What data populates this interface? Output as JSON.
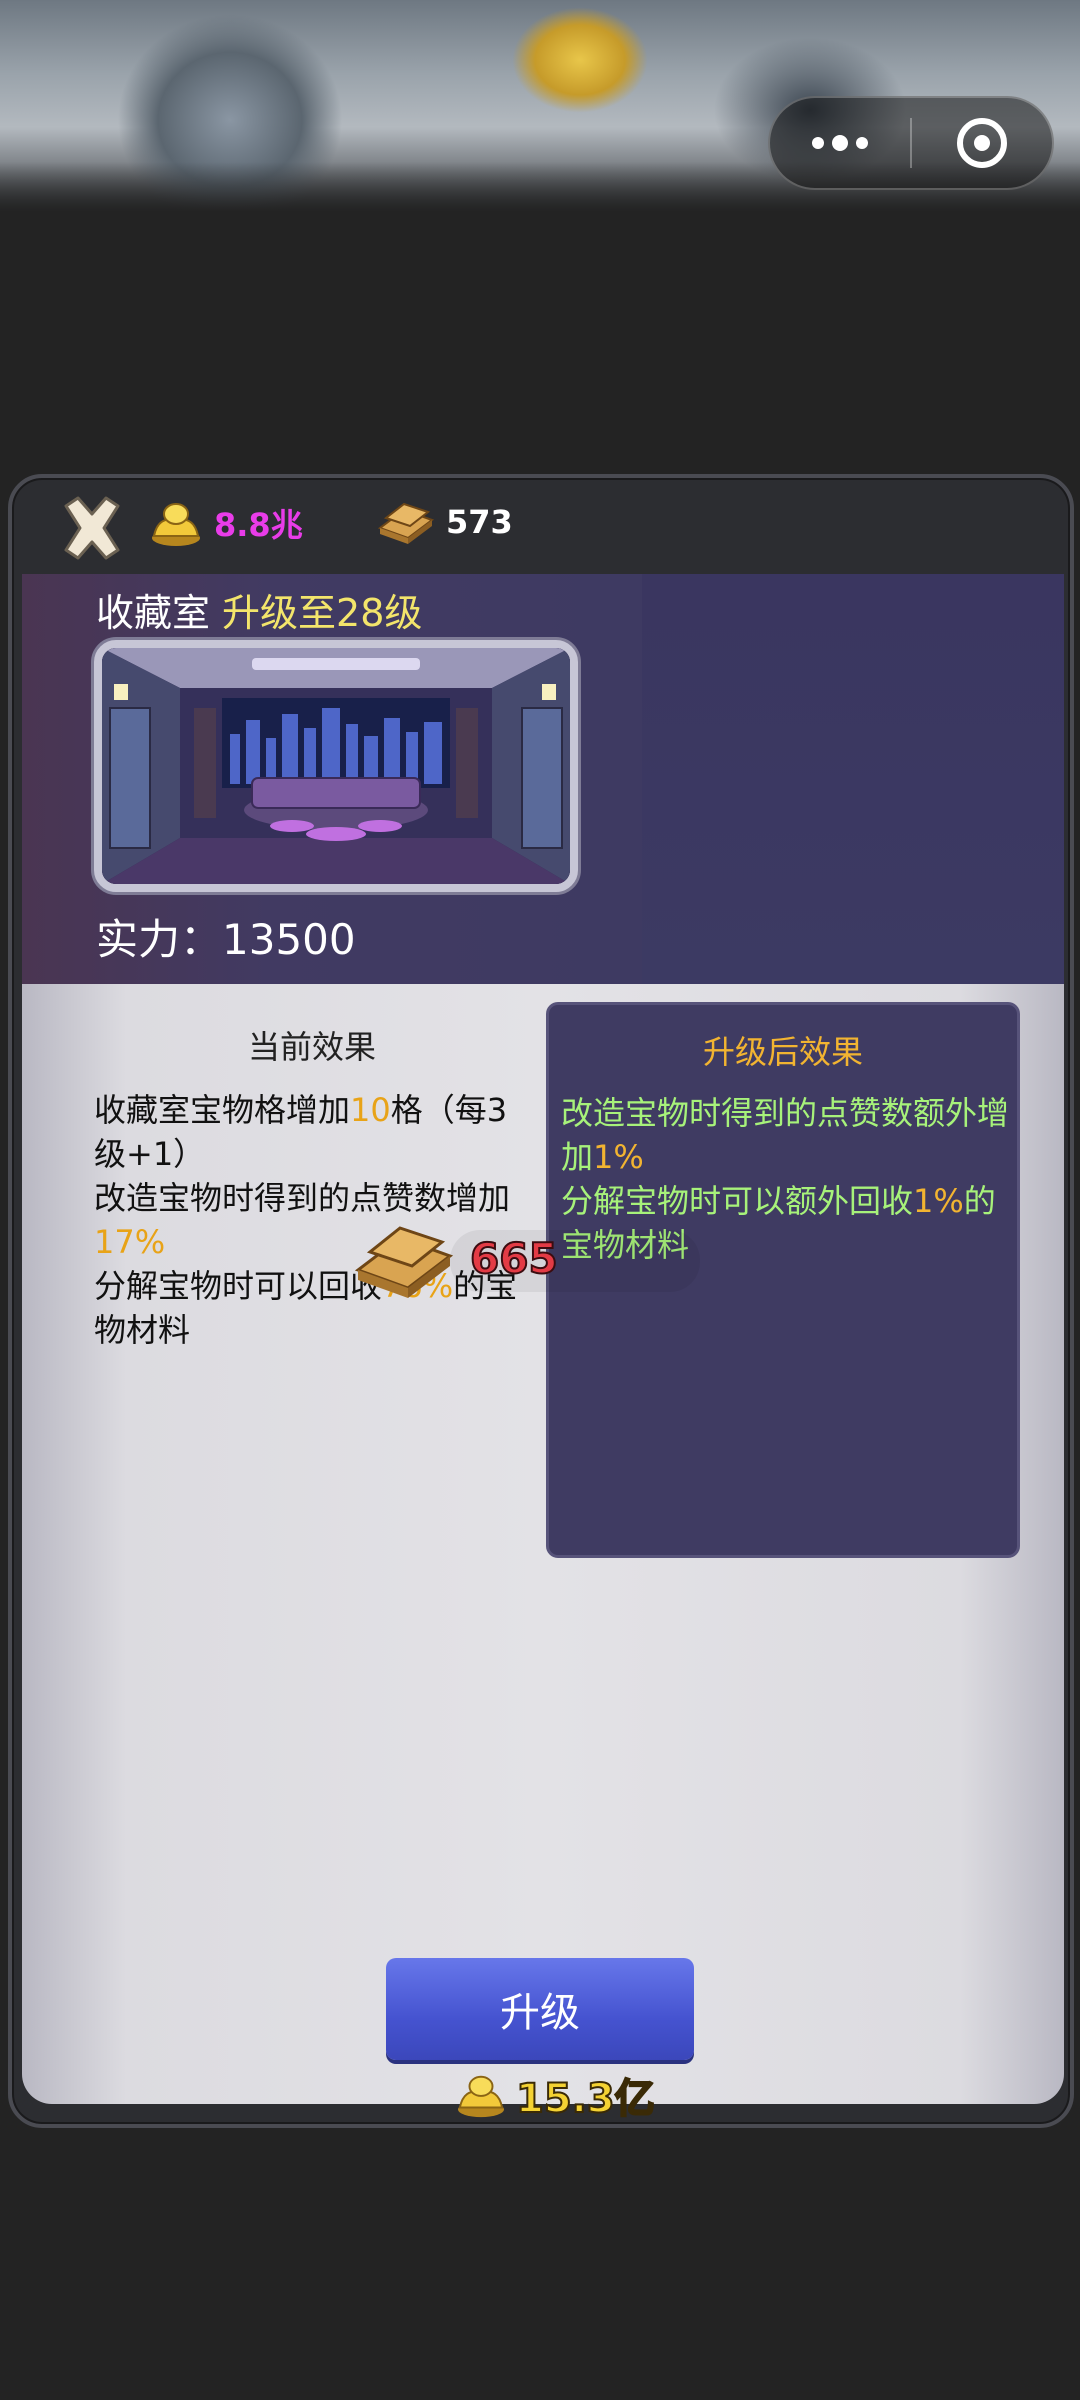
{
  "mini_program_capsule": {
    "more_icon": "more-dots-icon",
    "close_icon": "target-close-icon"
  },
  "header": {
    "gold_amount": "8.8兆",
    "wood_amount": "573"
  },
  "hero": {
    "room_name": "收藏室",
    "upgrade_text": "升级至28级",
    "power_label": "实力：",
    "power_value": "13500"
  },
  "current_effect": {
    "title": "当前效果",
    "line1_a": "收藏室宝物格增加",
    "line1_num": "10",
    "line1_b": "格（每3级+1）",
    "line2_a": "改造宝物时得到的点赞数增加",
    "line2_num": "17%",
    "line3_a": "分解宝物时可以回收",
    "line3_num": "76%",
    "line3_b": "的宝物材料"
  },
  "next_effect": {
    "title": "升级后效果",
    "line1_a": "改造宝物时得到的点赞数额外增加",
    "line1_num": "1%",
    "line2_a": "分解宝物时可以额外回收",
    "line2_num": "1%",
    "line2_b": "的宝物材料"
  },
  "cost": {
    "wood_required": "665"
  },
  "upgrade": {
    "button_label": "升级",
    "gold_price": "15.3亿"
  },
  "colors": {
    "accent_yellow": "#f3e56b",
    "effect_green": "#a7f27a",
    "cost_red": "#e33b45",
    "button_blue": "#4553d0"
  }
}
